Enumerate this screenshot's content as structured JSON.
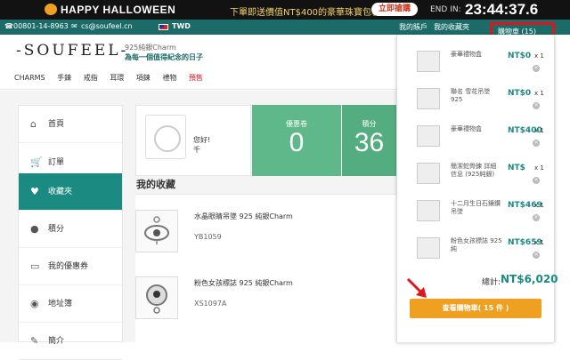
{
  "promo": {
    "title": "HAPPY HALLOWEEN",
    "message": "下單即送價值NT$400的豪華珠寶包裝盒",
    "cta": "立即搶購",
    "end_label": "END IN:",
    "countdown": "23:44:37.6"
  },
  "topbar": {
    "phone": "00801-14-8963",
    "email": "cs@soufeel.cn",
    "currency": "TWD",
    "account": "我的賬戶",
    "favorites": "我的收藏夾",
    "cart_label": "購物車 (15)"
  },
  "header": {
    "logo": "-SOUFEEL-",
    "tagline_top": "925純銀Charm",
    "tagline_bottom": "為每一個值得紀念的日子",
    "nav": [
      "CHARMS",
      "手鍊",
      "戒指",
      "耳環",
      "項鍊",
      "禮物",
      "預售"
    ]
  },
  "sidebar": {
    "items": [
      {
        "label": "首頁",
        "icon": "home-icon"
      },
      {
        "label": "訂單",
        "icon": "cart-icon"
      },
      {
        "label": "收藏夾",
        "icon": "heart-icon"
      },
      {
        "label": "積分",
        "icon": "piggy-bank-icon"
      },
      {
        "label": "我的優惠券",
        "icon": "coupon-icon"
      },
      {
        "label": "地址簿",
        "icon": "location-pin-icon"
      },
      {
        "label": "簡介",
        "icon": "pencil-icon"
      }
    ]
  },
  "profile": {
    "greeting": "您好!",
    "name": "千"
  },
  "stats": [
    {
      "label": "優惠卷",
      "value": "0"
    },
    {
      "label": "積分",
      "value": "36"
    }
  ],
  "favorites": {
    "title": "我的收藏",
    "items": [
      {
        "name": "水晶眼睛吊墜 925 純銀Charm",
        "sku": "YB1059"
      },
      {
        "name": "粉色女孩標誌 925 純銀Charm",
        "sku": "XS1097A"
      }
    ]
  },
  "cart": {
    "items": [
      {
        "name": "豪華禮物盒",
        "price": "NT$0",
        "qty": "x 1"
      },
      {
        "name": "聯名 雪花吊墜 925",
        "price": "NT$0",
        "qty": "x 1"
      },
      {
        "name": "豪華禮物盒",
        "price": "NT$400",
        "qty": "x 1"
      },
      {
        "name": "簡潔蛇骨鍊 詳細信息 (925純銀)",
        "price": "NT$",
        "qty": "x 1"
      },
      {
        "name": "十二月生日石鑲鑽吊墜",
        "price": "NT$469",
        "qty": "x 1"
      },
      {
        "name": "粉色女孩標誌 925 純",
        "price": "NT$659",
        "qty": "x 1"
      }
    ],
    "total_label": "總計:",
    "total": "NT$6,020",
    "checkout": "查看購物車( 15 件 )"
  },
  "colors": {
    "teal": "#1b6b68",
    "accent": "#1b8a80",
    "orange": "#f0a020",
    "highlight": "#e0141b"
  }
}
